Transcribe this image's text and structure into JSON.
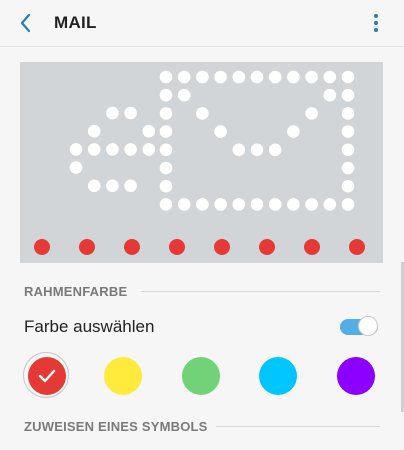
{
  "header": {
    "title": "MAIL",
    "back_icon": "chevron-left-icon",
    "more_icon": "more-vertical-icon"
  },
  "preview": {
    "background": "#d2d5d8",
    "dot_color": "#ffffff",
    "indicator_color": "#e53935",
    "indicator_count": 8,
    "icon": "mail-icon"
  },
  "sections": {
    "frame_color": "RAHMENFARBE",
    "assign_symbol": "ZUWEISEN EINES SYMBOLS"
  },
  "color_picker": {
    "label": "Farbe auswählen",
    "enabled": true,
    "accent": "#53aee6",
    "swatches": [
      {
        "name": "red",
        "color": "#e53935",
        "selected": true
      },
      {
        "name": "yellow",
        "color": "#ffeb3b",
        "selected": false
      },
      {
        "name": "green",
        "color": "#72d277",
        "selected": false
      },
      {
        "name": "cyan",
        "color": "#00c6ff",
        "selected": false
      },
      {
        "name": "purple",
        "color": "#8b00ff",
        "selected": false
      }
    ]
  }
}
